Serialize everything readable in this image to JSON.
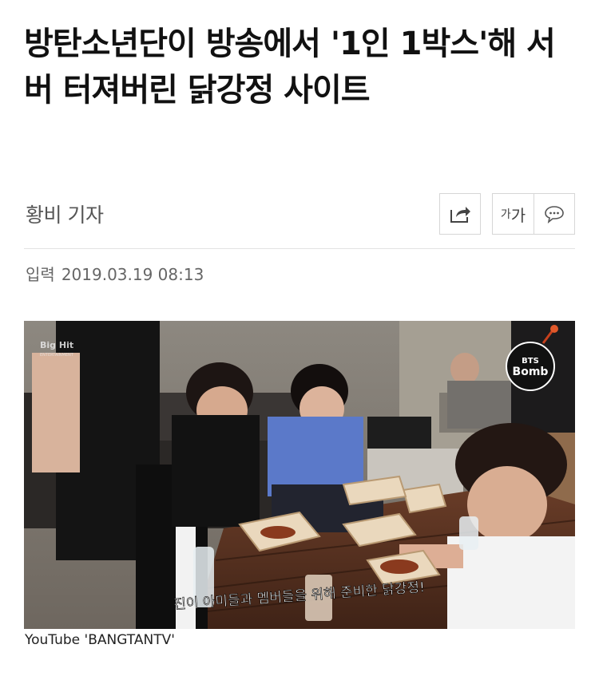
{
  "article": {
    "title": "방탄소년단이 방송에서 '1인 1박스'해 서버 터져버린 닭강정 사이트",
    "reporter": "황비 기자",
    "date_label": "입력",
    "date_value": "2019.03.19 08:13"
  },
  "toolbar": {
    "share_icon": "share-icon",
    "font_small": "가",
    "font_large": "가",
    "comment_icon": "comment-icon"
  },
  "photo": {
    "logo_text": "Big Hit",
    "logo_sub": "ENTERTAINMENT",
    "badge_line1": "BTS",
    "badge_line2": "Bomb",
    "subtitle": "진이 아미들과 멤버들을 위해 준비한 닭강정!",
    "caption": "YouTube 'BANGTANTV'"
  }
}
